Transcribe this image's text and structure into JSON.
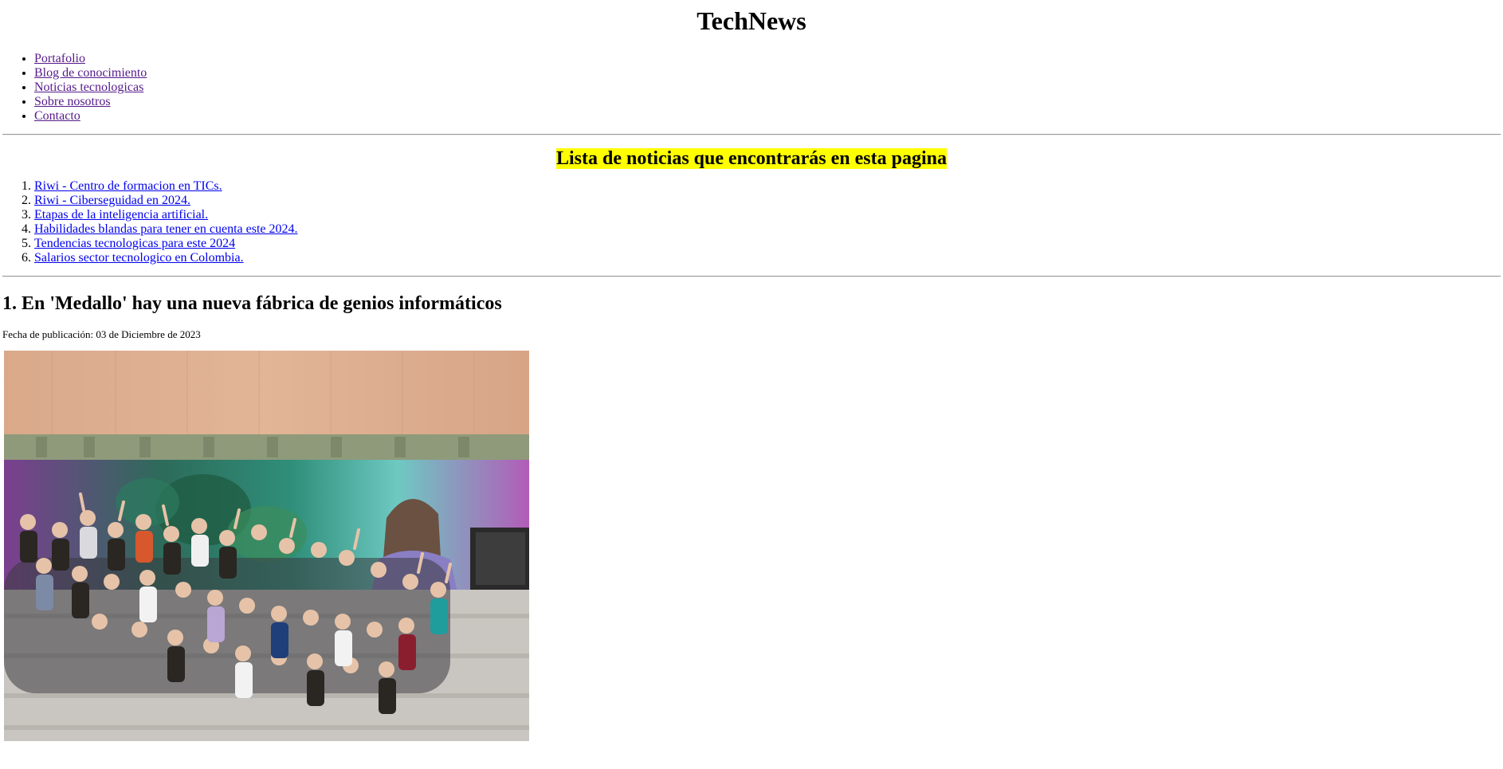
{
  "header": {
    "title": "TechNews"
  },
  "nav": {
    "items": [
      {
        "label": "Portafolio"
      },
      {
        "label": "Blog de conocimiento"
      },
      {
        "label": "Noticias tecnologicas"
      },
      {
        "label": "Sobre nosotros"
      },
      {
        "label": "Contacto"
      }
    ]
  },
  "news_list": {
    "heading": "Lista de noticias que encontrarás en esta pagina",
    "items": [
      {
        "label": "Riwi - Centro de formacion en TICs."
      },
      {
        "label": "Riwi - Ciberseguidad en 2024."
      },
      {
        "label": "Etapas de la inteligencia artificial."
      },
      {
        "label": "Habilidades blandas para tener en cuenta este 2024."
      },
      {
        "label": "Tendencias tecnologicas para este 2024"
      },
      {
        "label": "Salarios sector tecnologico en Colombia."
      }
    ]
  },
  "article": {
    "title": "1. En 'Medallo' hay una nueva fábrica de genios informáticos",
    "date": "Fecha de publicación: 03 de Diciembre de 2023"
  },
  "colors": {
    "highlight": "#ffff00",
    "visited_link": "#551a8b",
    "link": "#0000ee"
  }
}
